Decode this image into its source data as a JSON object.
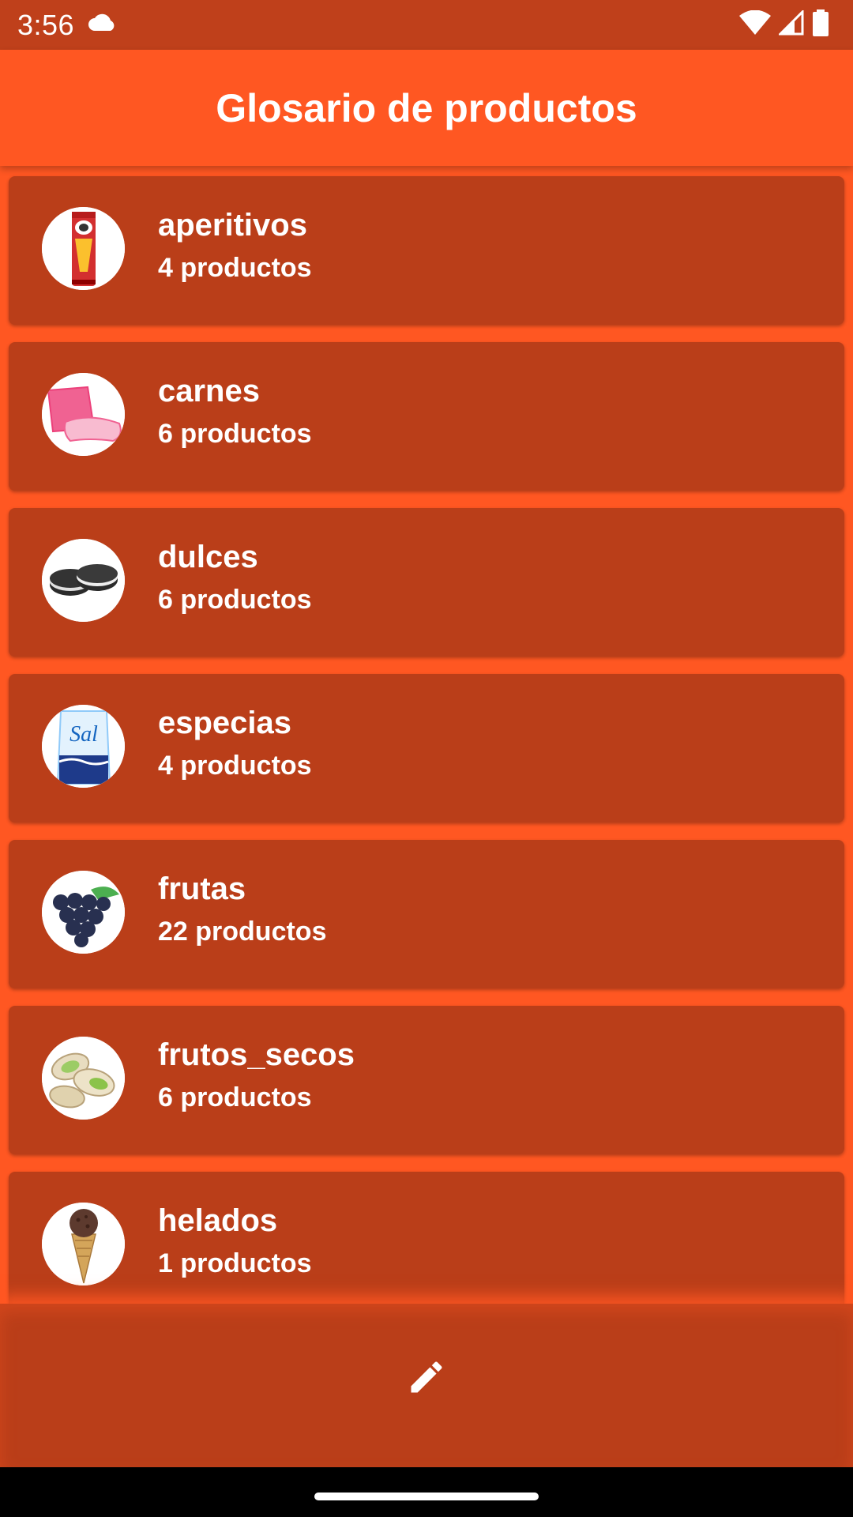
{
  "status_bar": {
    "time": "3:56",
    "icons": [
      "cloud-icon",
      "wifi-icon",
      "signal-icon",
      "battery-icon"
    ]
  },
  "app_bar": {
    "title": "Glosario de productos"
  },
  "categories": [
    {
      "name": "aperitivos",
      "count": "4 productos",
      "icon": "chips-can-icon"
    },
    {
      "name": "carnes",
      "count": "6 productos",
      "icon": "ham-slice-icon"
    },
    {
      "name": "dulces",
      "count": "6 productos",
      "icon": "cookies-icon"
    },
    {
      "name": "especias",
      "count": "4 productos",
      "icon": "salt-bag-icon"
    },
    {
      "name": "frutas",
      "count": "22 productos",
      "icon": "grapes-icon"
    },
    {
      "name": "frutos_secos",
      "count": "6 productos",
      "icon": "pistachios-icon"
    },
    {
      "name": "helados",
      "count": "1 productos",
      "icon": "ice-cream-cone-icon"
    }
  ],
  "thumb_labels": {
    "sal": "Sal"
  },
  "bottom_bar": {
    "action_icon": "pencil-icon"
  },
  "colors": {
    "primary": "#FF5722",
    "status_bar": "#BF401B",
    "card": "#BA3E19",
    "text": "#FFFFFF",
    "nav_bar": "#000000"
  }
}
